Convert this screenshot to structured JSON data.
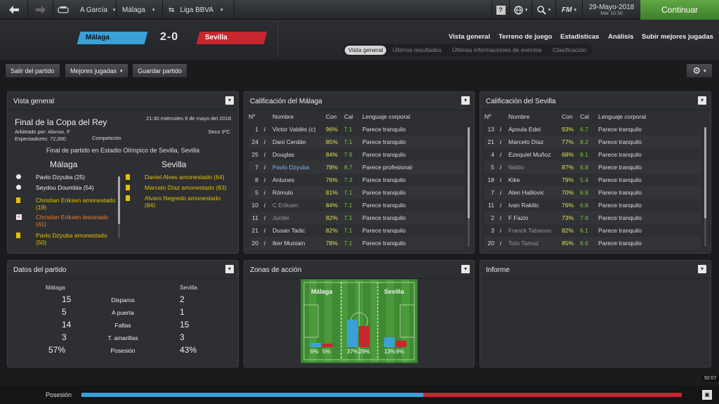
{
  "topbar": {
    "crumb_manager": "A García",
    "crumb_club": "Málaga",
    "crumb_league": "Liga BBVA",
    "date": "29-Mayo-2018",
    "time": "Mar 10:30",
    "fm_label": "FM",
    "continue_label": "Continuar",
    "help_label": "?"
  },
  "match": {
    "home": "Málaga",
    "away": "Sevilla",
    "score": "2-0",
    "home_color": "#3aa0d8",
    "away_color": "#c8262e"
  },
  "nav": {
    "items": [
      "Vista general",
      "Terreno de juego",
      "Estadísticas",
      "Análisis",
      "Subir mejores jugadas"
    ],
    "subtabs": [
      "Vista general",
      "Últimos resultados",
      "Últimas informaciones de eventos",
      "Clasificación"
    ]
  },
  "toolbar": {
    "leave": "Salir del partido",
    "best": "Mejores jugadas",
    "save": "Guardar partido"
  },
  "overview": {
    "title": "Vista general",
    "competition_title": "Final de la Copa del Rey",
    "datetime": "21:30 miércoles 9 de mayo del 2018",
    "referee": "Arbitrado por: Alonso, F",
    "attendance": "Espectadores: 72,000",
    "weather": "Seco 9ºC",
    "competition_label": "Competición",
    "venue": "Final de partido en Estadio Olímpico de Sevilla, Sevilla",
    "home_head": "Málaga",
    "away_head": "Sevilla",
    "home_events": [
      {
        "icon": "ball",
        "text": "Pavlo Dzyuba (25)",
        "color": "#eee"
      },
      {
        "icon": "ball",
        "text": "Seydou Doumbia (54)",
        "color": "#eee"
      },
      {
        "icon": "yellow",
        "text": "Christian Eriksen amonestado (19)",
        "color": "#e5c100"
      },
      {
        "icon": "injury",
        "text": "Christian Eriksen lesionado (41)",
        "color": "#e5803a"
      },
      {
        "icon": "yellow",
        "text": "Pavlo Dzyuba amonestado (50)",
        "color": "#e5c100"
      }
    ],
    "away_events": [
      {
        "icon": "yellow",
        "text": "Daniel Alves amonestado (64)"
      },
      {
        "icon": "yellow",
        "text": "Marcelo Díaz amonestado (83)"
      },
      {
        "icon": "yellow",
        "text": "Alvaro Negredo amonestado (84)"
      }
    ]
  },
  "ratings_headers": {
    "n": "Nº",
    "name": "Nombre",
    "con": "Con",
    "cal": "Cal",
    "lang": "Lenguaje corporal"
  },
  "malaga_ratings": {
    "title": "Calificación del Málaga",
    "rows": [
      {
        "n": "1",
        "name": "Victor Valdés (c)",
        "con": "96%",
        "cal": "7.1",
        "lang": "Parece tranquilo",
        "style": ""
      },
      {
        "n": "24",
        "name": "Dani Cerdán",
        "con": "85%",
        "cal": "7.1",
        "lang": "Parece tranquilo",
        "style": ""
      },
      {
        "n": "25",
        "name": "Douglas",
        "con": "84%",
        "cal": "7.9",
        "lang": "Parece tranquilo",
        "style": ""
      },
      {
        "n": "7",
        "name": "Pavlo Dzyuba",
        "con": "78%",
        "cal": "8.7",
        "lang": "Parece profesional",
        "style": "blue"
      },
      {
        "n": "8",
        "name": "Antunes",
        "con": "76%",
        "cal": "7.3",
        "lang": "Parece tranquilo",
        "style": ""
      },
      {
        "n": "5",
        "name": "Rómulo",
        "con": "81%",
        "cal": "7.1",
        "lang": "Parece tranquilo",
        "style": ""
      },
      {
        "n": "10",
        "name": "C Eriksen",
        "con": "84%",
        "cal": "7.1",
        "lang": "Parece tranquilo",
        "style": "dim"
      },
      {
        "n": "11",
        "name": "Jucilei",
        "con": "82%",
        "cal": "7.1",
        "lang": "Parece tranquilo",
        "style": "dim"
      },
      {
        "n": "21",
        "name": "Dusan Tadic",
        "con": "82%",
        "cal": "7.1",
        "lang": "Parece tranquilo",
        "style": ""
      },
      {
        "n": "20",
        "name": "Iker Muniain",
        "con": "78%",
        "cal": "7.1",
        "lang": "Parece tranquilo",
        "style": ""
      }
    ]
  },
  "sevilla_ratings": {
    "title": "Calificación del Sevilla",
    "rows": [
      {
        "n": "13",
        "name": "Apoula Edel",
        "con": "93%",
        "cal": "6.7",
        "lang": "Parece tranquilo",
        "style": ""
      },
      {
        "n": "21",
        "name": "Marcelo Díaz",
        "con": "77%",
        "cal": "8.2",
        "lang": "Parece tranquilo",
        "style": ""
      },
      {
        "n": "4",
        "name": "Ezequiel Muñoz",
        "con": "68%",
        "cal": "8.1",
        "lang": "Parece tranquilo",
        "style": ""
      },
      {
        "n": "5",
        "name": "Naldo",
        "con": "87%",
        "cal": "6.8",
        "lang": "Parece tranquilo",
        "style": "dim"
      },
      {
        "n": "18",
        "name": "Kike",
        "con": "79%",
        "cal": "5.4",
        "lang": "Parece tranquilo",
        "style": ""
      },
      {
        "n": "7",
        "name": "Alen Halilovic",
        "con": "70%",
        "cal": "6.9",
        "lang": "Parece tranquilo",
        "style": ""
      },
      {
        "n": "11",
        "name": "Ivan Rakitic",
        "con": "76%",
        "cal": "6.8",
        "lang": "Parece tranquilo",
        "style": ""
      },
      {
        "n": "2",
        "name": "F Fazio",
        "con": "73%",
        "cal": "7.8",
        "lang": "Parece tranquilo",
        "style": ""
      },
      {
        "n": "3",
        "name": "Franck Tabanou",
        "con": "82%",
        "cal": "6.1",
        "lang": "Parece tranquilo",
        "style": "dim"
      },
      {
        "n": "20",
        "name": "Toto Tamuz",
        "con": "85%",
        "cal": "6.6",
        "lang": "Parece tranquilo",
        "style": "dim"
      }
    ]
  },
  "match_stats": {
    "title": "Datos del partido",
    "home": "Málaga",
    "away": "Sevilla",
    "rows": [
      {
        "label": "Disparos",
        "home": "15",
        "away": "2"
      },
      {
        "label": "A puerta",
        "home": "5",
        "away": "1"
      },
      {
        "label": "Faltas",
        "home": "14",
        "away": "15"
      },
      {
        "label": "T. amarillas",
        "home": "3",
        "away": "3"
      },
      {
        "label": "Posesión",
        "home": "57%",
        "away": "43%"
      }
    ]
  },
  "action_zones": {
    "title": "Zonas de acción",
    "home": "Málaga",
    "away": "Sevilla",
    "zones": [
      {
        "home": "6%",
        "away": "5%",
        "home_v": 6,
        "away_v": 5
      },
      {
        "home": "37%",
        "away": "29%",
        "home_v": 37,
        "away_v": 29
      },
      {
        "home": "13%",
        "away": "9%",
        "home_v": 13,
        "away_v": 9
      }
    ]
  },
  "report": {
    "title": "Informe"
  },
  "possession": {
    "label": "Posesión",
    "home_pct": 57,
    "clock": "92:07"
  }
}
